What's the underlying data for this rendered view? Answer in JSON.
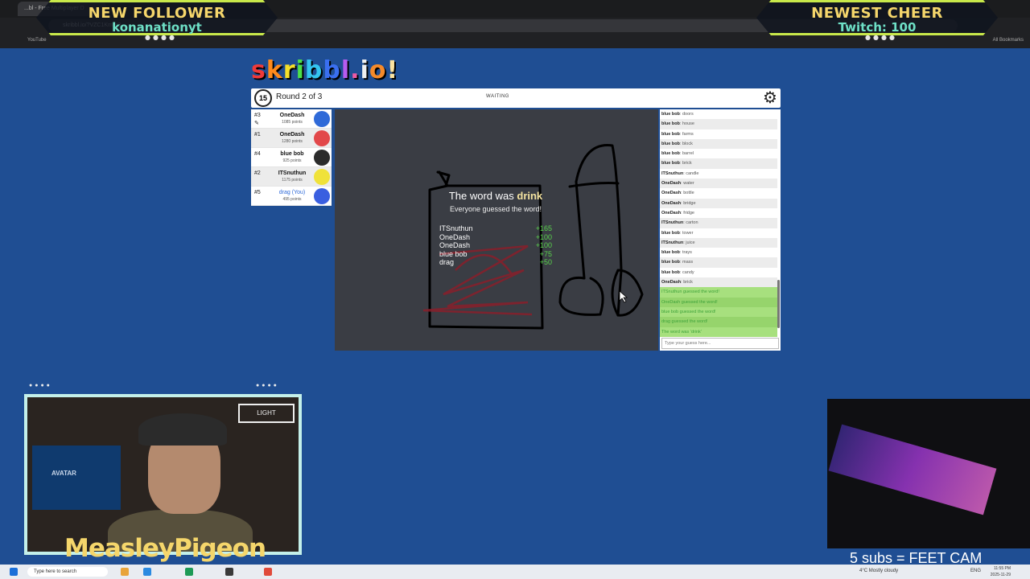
{
  "browser": {
    "tab_title": "...bl - Free Multiplayer D",
    "url": "skribbl.io/?VZC1KmFr3",
    "bookmark_youtube": "YouTube",
    "bookmark_all": "All Bookmarks"
  },
  "alerts": {
    "left_title": "NEW FOLLOWER",
    "left_subtitle": "konanationyt",
    "right_title": "NEWEST CHEER",
    "right_subtitle": "Twitch: 100"
  },
  "logo_chars": [
    "s",
    "k",
    "r",
    "i",
    "b",
    "b",
    "l",
    ".",
    "i",
    "o",
    "!"
  ],
  "header": {
    "timer": "15",
    "round": "Round 2 of 3",
    "status": "WAITING"
  },
  "players": [
    {
      "rank": "#3",
      "name": "OneDash",
      "points": "1085 points",
      "color": "#2f6ad8",
      "you": false
    },
    {
      "rank": "#1",
      "name": "OneDash",
      "points": "1280 points",
      "color": "#e2484a",
      "you": false
    },
    {
      "rank": "#4",
      "name": "blue bob",
      "points": "925 points",
      "color": "#2b2b2b",
      "you": false
    },
    {
      "rank": "#2",
      "name": "ITSnuthun",
      "points": "1175 points",
      "color": "#f0e23a",
      "you": false
    },
    {
      "rank": "#5",
      "name": "drag (You)",
      "points": "495 points",
      "color": "#3a5fe0",
      "you": true
    }
  ],
  "canvas": {
    "word_prefix": "The word was",
    "word": "drink",
    "subtitle": "Everyone guessed the word!",
    "results": [
      {
        "name": "ITSnuthun",
        "points": "+165"
      },
      {
        "name": "OneDash",
        "points": "+100"
      },
      {
        "name": "OneDash",
        "points": "+100"
      },
      {
        "name": "blue bob",
        "points": "+75"
      },
      {
        "name": "drag",
        "points": "+50"
      }
    ]
  },
  "chat": {
    "messages": [
      {
        "user": "blue bob",
        "text": "doors",
        "green": false
      },
      {
        "user": "blue bob",
        "text": "house",
        "green": false
      },
      {
        "user": "blue bob",
        "text": "farms",
        "green": false
      },
      {
        "user": "blue bob",
        "text": "block",
        "green": false
      },
      {
        "user": "blue bob",
        "text": "barrel",
        "green": false
      },
      {
        "user": "blue bob",
        "text": "brick",
        "green": false
      },
      {
        "user": "ITSnuthun",
        "text": "candle",
        "green": false
      },
      {
        "user": "OneDash",
        "text": "water",
        "green": false
      },
      {
        "user": "OneDash",
        "text": "bottle",
        "green": false
      },
      {
        "user": "OneDash",
        "text": "bridge",
        "green": false
      },
      {
        "user": "OneDash",
        "text": "fridge",
        "green": false
      },
      {
        "user": "ITSnuthun",
        "text": "carton",
        "green": false
      },
      {
        "user": "blue bob",
        "text": "tower",
        "green": false
      },
      {
        "user": "ITSnuthun",
        "text": "juice",
        "green": false
      },
      {
        "user": "blue bob",
        "text": "trays",
        "green": false
      },
      {
        "user": "blue bob",
        "text": "mass",
        "green": false
      },
      {
        "user": "blue bob",
        "text": "candy",
        "green": false
      },
      {
        "user": "OneDash",
        "text": "brick",
        "green": false
      },
      {
        "user": "",
        "text": "ITSnuthun guessed the word!",
        "green": true
      },
      {
        "user": "",
        "text": "OneDash guessed the word!",
        "green": true
      },
      {
        "user": "",
        "text": "blue bob guessed the word!",
        "green": true
      },
      {
        "user": "",
        "text": "drag guessed the word!",
        "green": true
      },
      {
        "user": "",
        "text": "The word was 'drink'",
        "green": true
      }
    ],
    "input_placeholder": "Type your guess here..."
  },
  "stream": {
    "streamer_name": "MeasleyPigeon",
    "tv_text": "AVATAR",
    "sign_text": "LIGHT",
    "subs_text": "5 subs = FEET CAM"
  },
  "taskbar": {
    "search_placeholder": "Type here to search",
    "weather": "4°C  Mostly cloudy",
    "lang": "ENG",
    "time": "11:55 PM",
    "date": "2025-11-29"
  }
}
